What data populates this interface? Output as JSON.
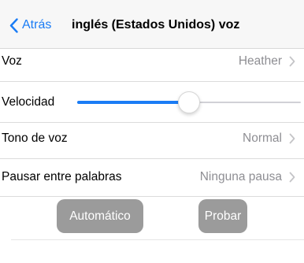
{
  "nav": {
    "back_label": "Atrás",
    "title": "inglés (Estados Unidos) voz"
  },
  "settings": {
    "voz": {
      "label": "Voz",
      "value": "Heather"
    },
    "velocidad": {
      "label": "Velocidad",
      "level": 0.5
    },
    "tono": {
      "label": "Tono de voz",
      "value": "Normal"
    },
    "pausar": {
      "label": "Pausar entre palabras",
      "value": "Ninguna pausa"
    }
  },
  "buttons": {
    "automatico": "Automático",
    "probar": "Probar"
  },
  "colors": {
    "accent": "#1a7cf5",
    "button_bg": "#9b9b9b",
    "secondary_text": "#8e8e93"
  },
  "icons": {
    "back": "chevron-left-icon",
    "row_disclosure": "chevron-right-icon"
  }
}
